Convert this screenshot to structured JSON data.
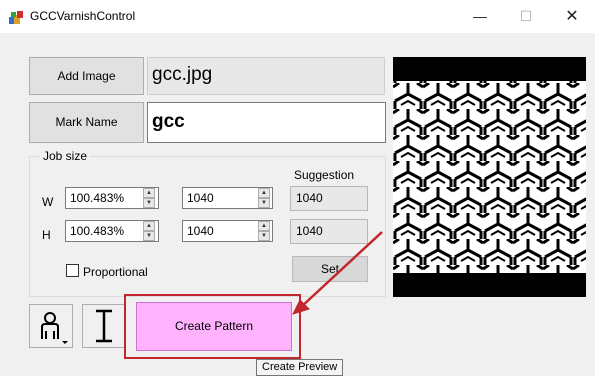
{
  "window": {
    "title": "GCCVarnishControl",
    "minimize_glyph": "—",
    "maximize_glyph": "☐",
    "close_glyph": "✕"
  },
  "image": {
    "add_button_label": "Add Image",
    "filename": "gcc.jpg"
  },
  "mark": {
    "button_label": "Mark Name",
    "value": "gcc"
  },
  "job_size": {
    "label": "Job size",
    "suggestion_label": "Suggestion",
    "w_label": "W",
    "h_label": "H",
    "w_percent": "100.483%",
    "h_percent": "100.483%",
    "w_value": "1040",
    "h_value": "1040",
    "w_suggestion": "1040",
    "h_suggestion": "1040",
    "proportional_label": "Proportional",
    "proportional_checked": false,
    "set_label": "Set"
  },
  "toolbar": {
    "person_icon": "person-dropdown-icon",
    "text_icon": "text-cursor-icon",
    "create_pattern_label": "Create Pattern",
    "tooltip": "Create Preview"
  },
  "annotation": {
    "highlight_color": "#c1272d"
  }
}
